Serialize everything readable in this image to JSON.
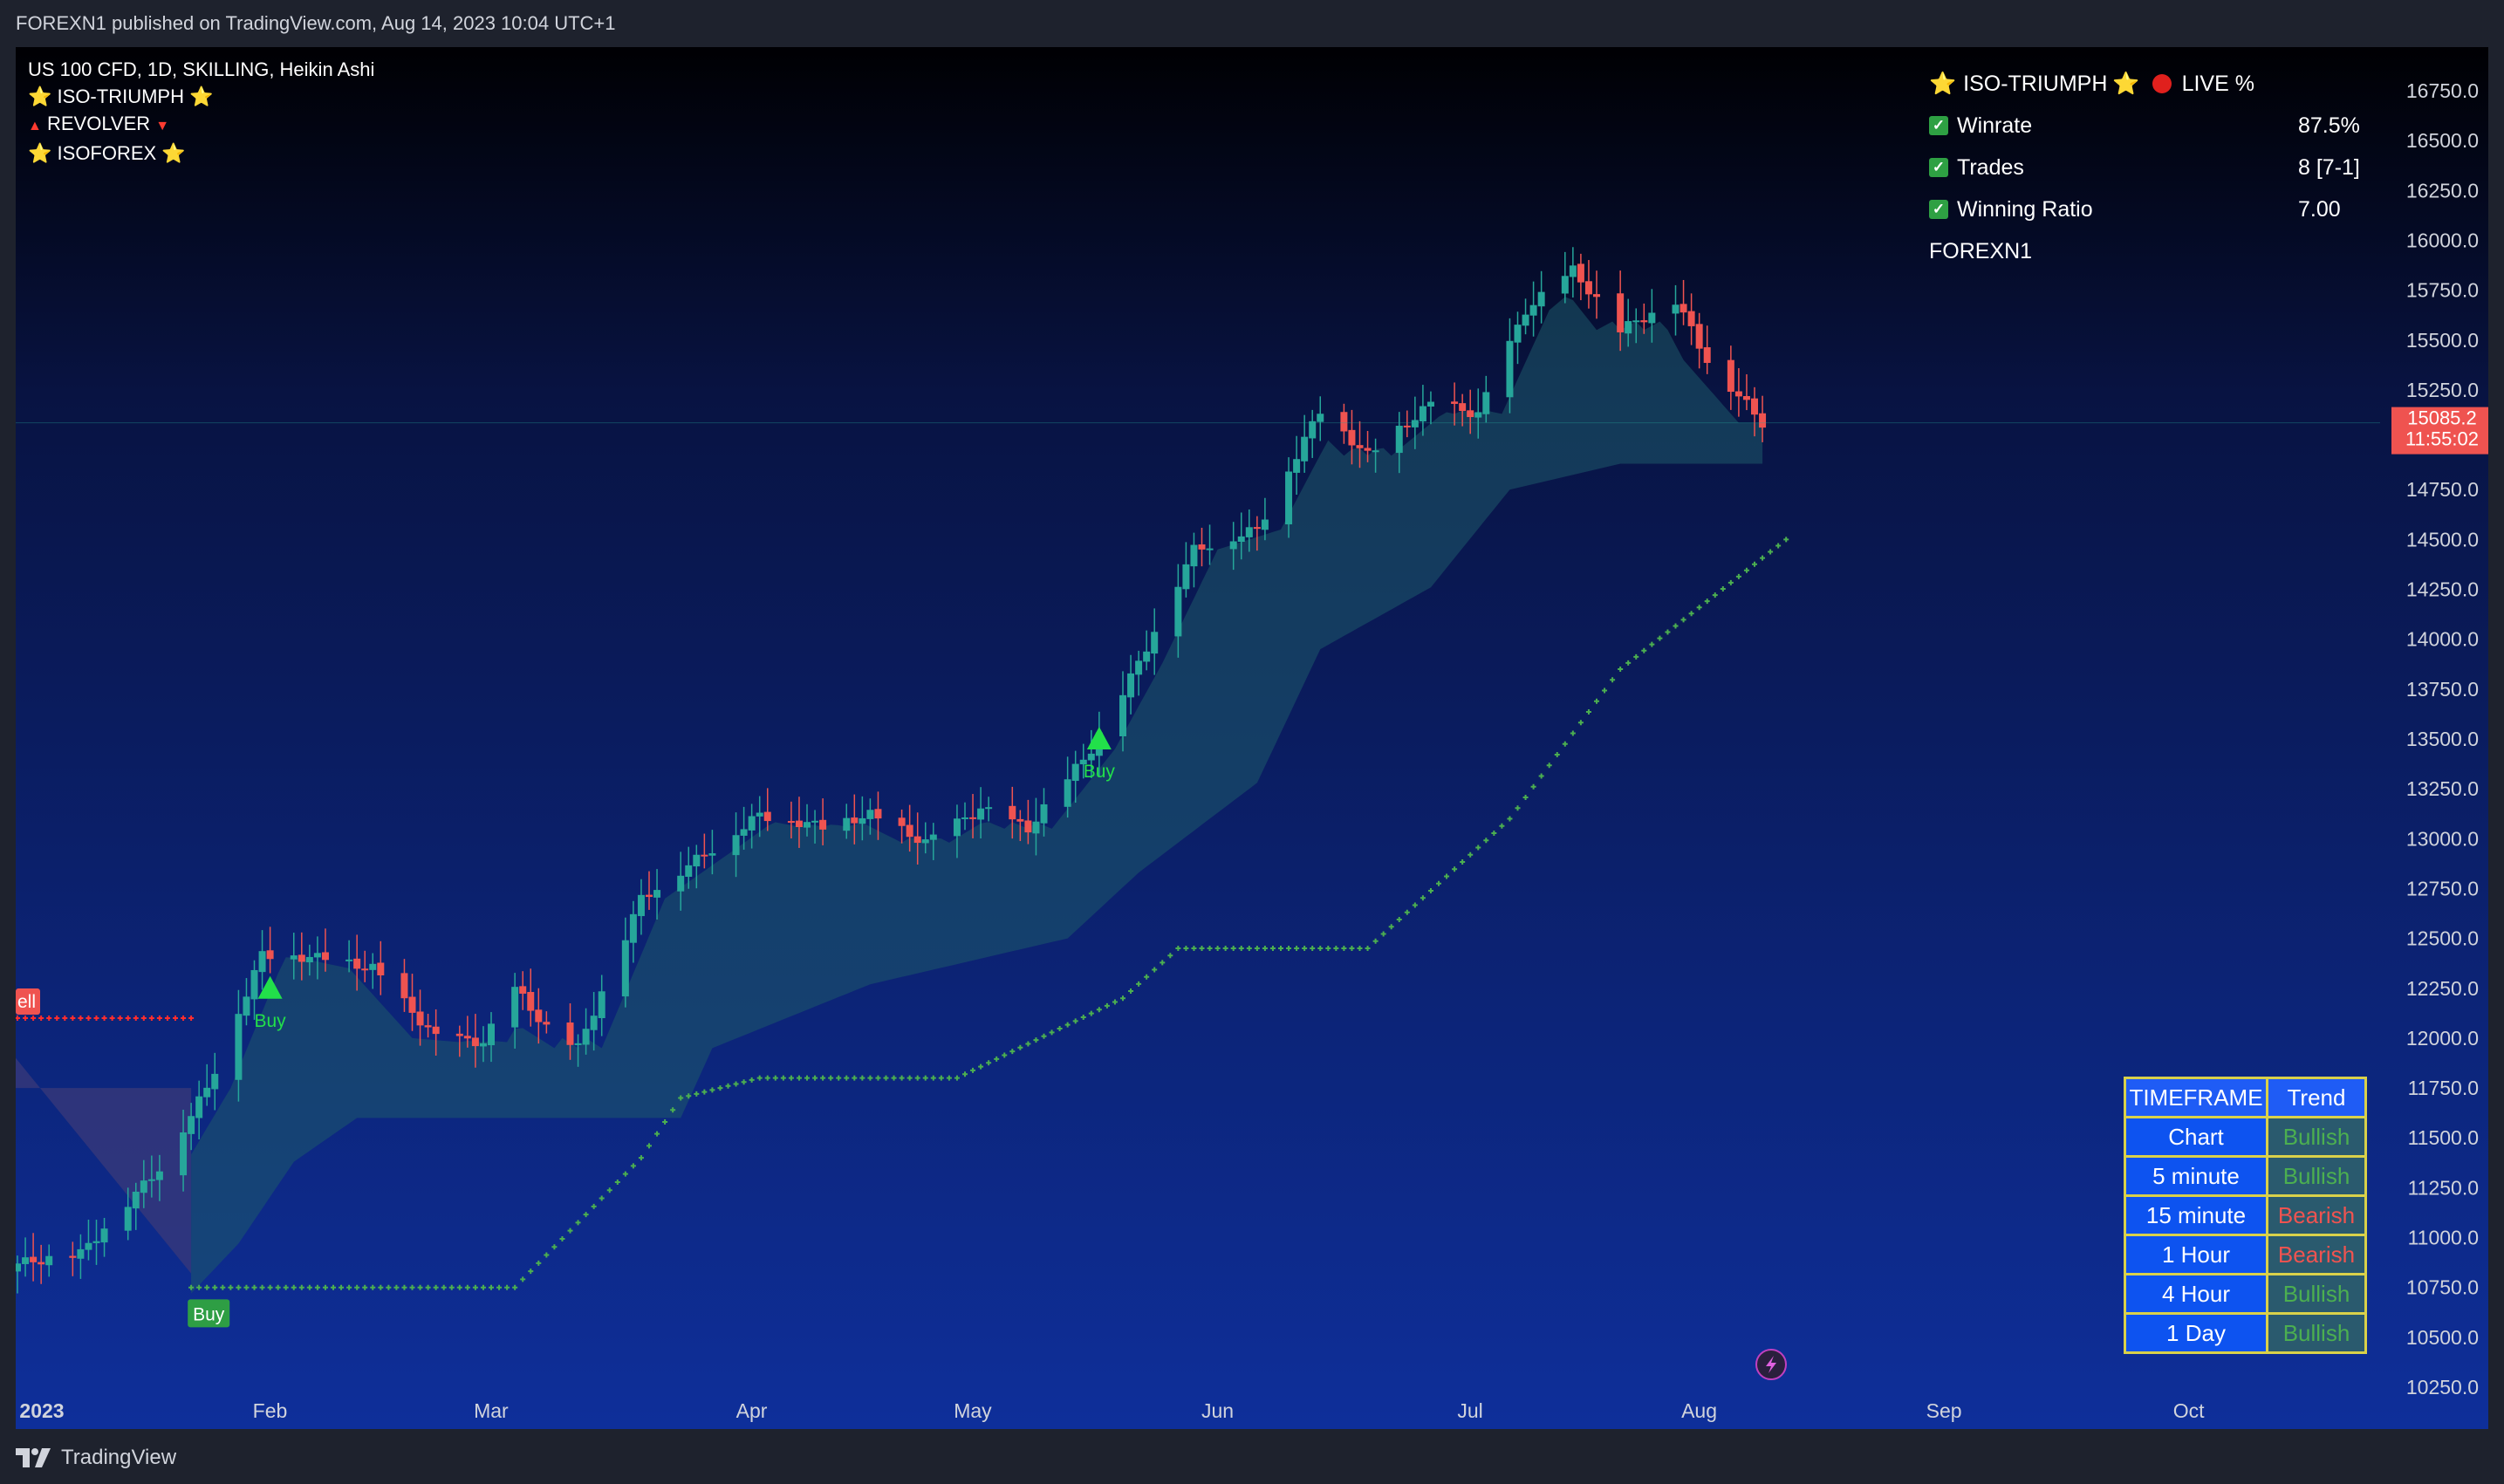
{
  "header": {
    "publish_line": "FOREXN1 published on TradingView.com, Aug 14, 2023 10:04 UTC+1"
  },
  "footer": {
    "brand": "TradingView",
    "brand_icon": "tradingview-logo-icon"
  },
  "legend": {
    "symbol_line": "US 100 CFD, 1D, SKILLING, Heikin Ashi",
    "indicators": [
      {
        "label": "ISO-TRIUMPH",
        "prefix_icon": "star-icon",
        "suffix_icon": "star-icon"
      },
      {
        "label": "REVOLVER",
        "prefix_icon": "red-triangle-up-icon",
        "suffix_icon": "red-triangle-down-icon"
      },
      {
        "label": "ISOFOREX",
        "prefix_icon": "star-icon",
        "suffix_icon": "star-icon"
      }
    ]
  },
  "stats_panel": {
    "title": "ISO-TRIUMPH",
    "live_label": "LIVE %",
    "rows": [
      {
        "label": "Winrate",
        "value": "87.5%"
      },
      {
        "label": "Trades",
        "value": "8 [7-1]"
      },
      {
        "label": "Winning Ratio",
        "value": "7.00"
      }
    ],
    "author": "FOREXN1"
  },
  "trend_table": {
    "headers": [
      "TIMEFRAME",
      "Trend"
    ],
    "rows": [
      {
        "timeframe": "Chart",
        "trend": "Bullish"
      },
      {
        "timeframe": "5 minute",
        "trend": "Bullish"
      },
      {
        "timeframe": "15 minute",
        "trend": "Bearish"
      },
      {
        "timeframe": "1 Hour",
        "trend": "Bearish"
      },
      {
        "timeframe": "4 Hour",
        "trend": "Bullish"
      },
      {
        "timeframe": "1 Day",
        "trend": "Bullish"
      }
    ]
  },
  "signals": [
    {
      "label": "Buy",
      "date_index": 33
    },
    {
      "label": "Buy",
      "date_index": 118
    },
    {
      "label": "Buy",
      "date_index": 22,
      "style": "boxed"
    },
    {
      "label": "ell",
      "style": "boxed-red"
    }
  ],
  "price_label": {
    "price": "15085.2",
    "countdown": "11:55:02"
  },
  "colors": {
    "bull": "#26a69a",
    "bear": "#ef5350",
    "band_fill": "#1e5a6a",
    "band_pre_fill": "#3a3a7a",
    "dotted_green": "#4caf50",
    "dotted_red": "#ff2d2d",
    "price_label_bg": "#ef5350",
    "bullish_text": "#4caf50",
    "bearish_text": "#ef5350",
    "table_border": "#d9d14a"
  },
  "chart_data": {
    "type": "candlestick",
    "title": "US 100 CFD, 1D, SKILLING, Heikin Ashi",
    "y_ticks": [
      10250,
      10500,
      10750,
      11000,
      11250,
      11500,
      11750,
      12000,
      12250,
      12500,
      12750,
      13000,
      13250,
      13500,
      13750,
      14000,
      14250,
      14500,
      14750,
      15000,
      15250,
      15500,
      15750,
      16000,
      16250,
      16500,
      16750
    ],
    "ylim": [
      10050,
      16880
    ],
    "x_ticks": [
      "2023",
      "Feb",
      "Mar",
      "Apr",
      "May",
      "Jun",
      "Jul",
      "Aug",
      "Sep",
      "Oct"
    ],
    "x_range": [
      "2023-01-02",
      "2023-10-06"
    ],
    "close_anchors": [
      [
        "2023-01-02",
        10870
      ],
      [
        "2023-01-10",
        10920
      ],
      [
        "2023-01-20",
        11350
      ],
      [
        "2023-01-26",
        11750
      ],
      [
        "2023-02-02",
        12420
      ],
      [
        "2023-02-10",
        12400
      ],
      [
        "2023-02-16",
        12350
      ],
      [
        "2023-02-24",
        12000
      ],
      [
        "2023-03-02",
        11980
      ],
      [
        "2023-03-06",
        12250
      ],
      [
        "2023-03-10",
        12050
      ],
      [
        "2023-03-14",
        11950
      ],
      [
        "2023-03-22",
        12700
      ],
      [
        "2023-03-31",
        12950
      ],
      [
        "2023-04-06",
        13120
      ],
      [
        "2023-04-14",
        13060
      ],
      [
        "2023-04-20",
        13120
      ],
      [
        "2023-04-27",
        12980
      ],
      [
        "2023-05-04",
        13150
      ],
      [
        "2023-05-10",
        13050
      ],
      [
        "2023-05-18",
        13450
      ],
      [
        "2023-05-24",
        13880
      ],
      [
        "2023-05-31",
        14450
      ],
      [
        "2023-06-08",
        14550
      ],
      [
        "2023-06-16",
        15150
      ],
      [
        "2023-06-22",
        14920
      ],
      [
        "2023-06-30",
        15180
      ],
      [
        "2023-07-06",
        15130
      ],
      [
        "2023-07-12",
        15650
      ],
      [
        "2023-07-18",
        15850
      ],
      [
        "2023-07-24",
        15550
      ],
      [
        "2023-07-31",
        15700
      ],
      [
        "2023-08-04",
        15400
      ],
      [
        "2023-08-11",
        15085
      ]
    ],
    "current_price": 15085.2,
    "band_lower_anchors": [
      [
        "2023-01-24",
        10720
      ],
      [
        "2023-01-30",
        10970
      ],
      [
        "2023-02-06",
        11380
      ],
      [
        "2023-02-14",
        11600
      ],
      [
        "2023-03-27",
        11600
      ],
      [
        "2023-03-31",
        11950
      ],
      [
        "2023-04-20",
        12270
      ],
      [
        "2023-05-15",
        12500
      ],
      [
        "2023-05-24",
        12830
      ],
      [
        "2023-06-08",
        13280
      ],
      [
        "2023-06-16",
        13950
      ],
      [
        "2023-06-30",
        14260
      ],
      [
        "2023-07-10",
        14750
      ],
      [
        "2023-07-24",
        14880
      ],
      [
        "2023-08-14",
        14880
      ]
    ],
    "pre_band_top": 11750,
    "dotted_support_anchors": [
      [
        "2023-01-24",
        10750
      ],
      [
        "2023-03-06",
        10750
      ],
      [
        "2023-03-22",
        11400
      ],
      [
        "2023-03-27",
        11700
      ],
      [
        "2023-04-06",
        11800
      ],
      [
        "2023-05-01",
        11800
      ],
      [
        "2023-05-22",
        12200
      ],
      [
        "2023-05-29",
        12450
      ],
      [
        "2023-06-22",
        12450
      ],
      [
        "2023-07-10",
        13100
      ],
      [
        "2023-07-24",
        13850
      ],
      [
        "2023-08-14",
        14500
      ]
    ],
    "dotted_resistance": {
      "from": "2023-01-02",
      "to": "2023-01-24",
      "value": 12100
    }
  }
}
